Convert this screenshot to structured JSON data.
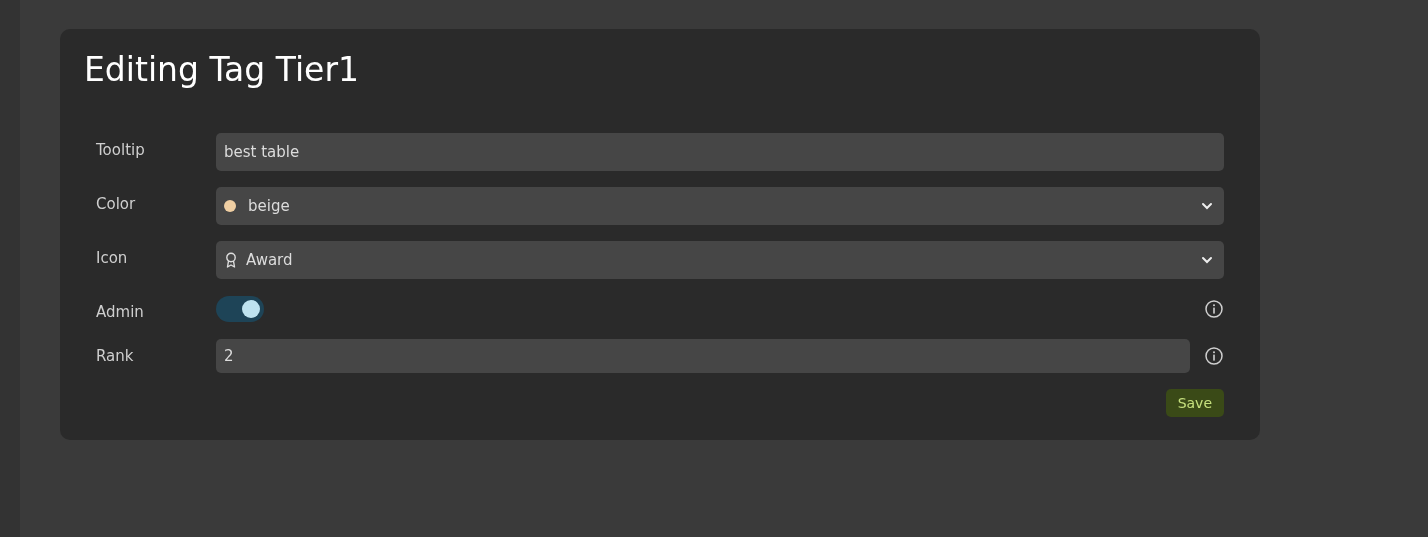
{
  "dialog": {
    "title": "Editing Tag Tier1",
    "fields": [
      {
        "kind": "text",
        "label": "Tooltip",
        "value": "best table"
      },
      {
        "kind": "color",
        "label": "Color",
        "value": "beige",
        "color": "#f0cfa3"
      },
      {
        "kind": "icon",
        "label": "Icon",
        "value": "Award"
      },
      {
        "kind": "toggle",
        "label": "Admin",
        "on": true,
        "info": true
      },
      {
        "kind": "number",
        "label": "Rank",
        "value": "2",
        "info": true
      }
    ],
    "save_button": "Save"
  }
}
